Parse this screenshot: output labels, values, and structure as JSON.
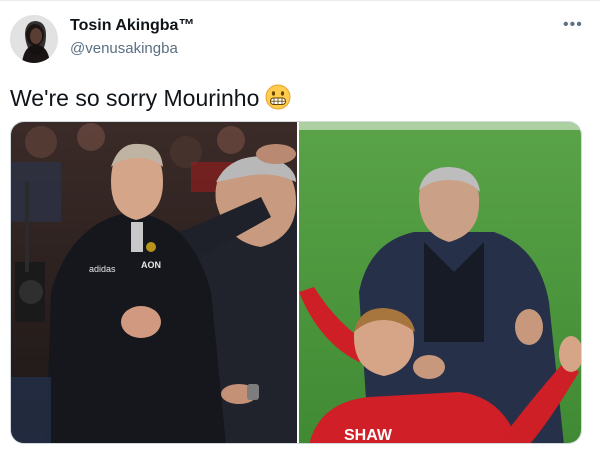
{
  "tweet": {
    "author_name": "Tosin Akingba™",
    "author_handle": "@venusakingba",
    "more_icon": "more-horizontal-icon",
    "text": "We're so sorry Mourinho",
    "emoji": "grimacing-face-emoji"
  },
  "media": {
    "left_photo": {
      "jacket_sponsor": "AON",
      "badge": "adidas"
    },
    "right_photo": {
      "shirt_name": "SHAW"
    }
  },
  "colors": {
    "name": "#0f1419",
    "handle": "#5b7083",
    "divider": "#e6ecf0",
    "pitch": "#4e9a3c",
    "kit_red": "#d71f26"
  }
}
